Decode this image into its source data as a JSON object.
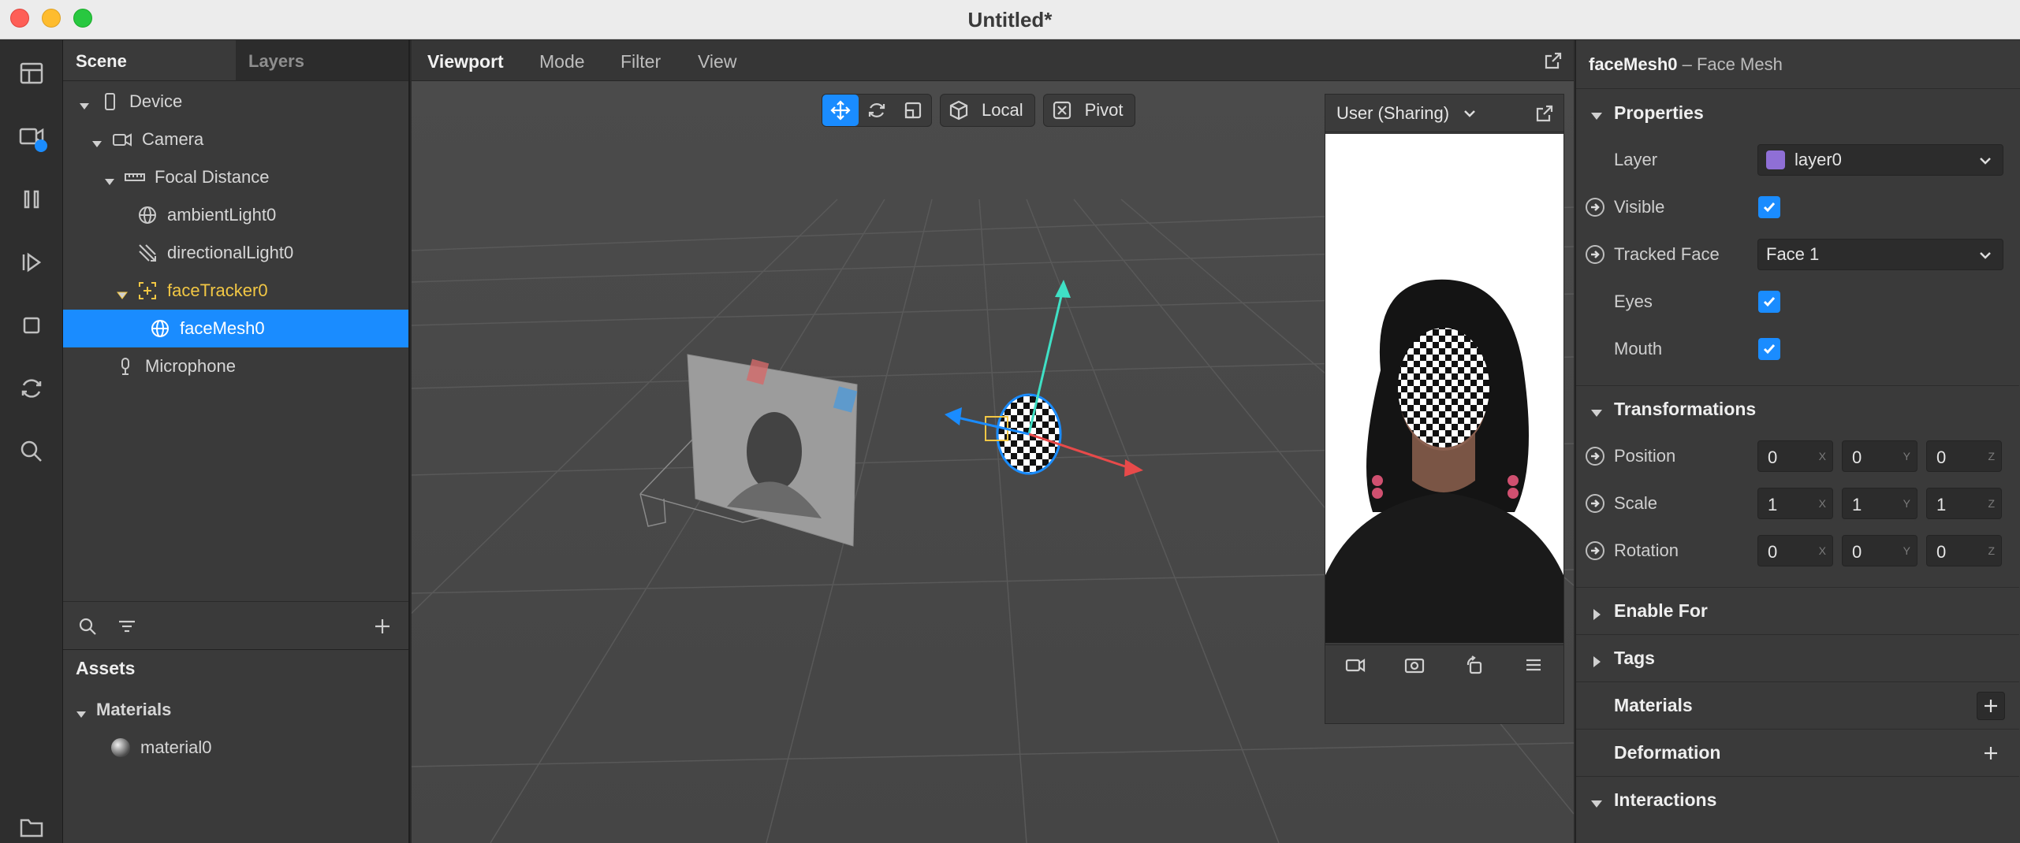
{
  "window": {
    "title": "Untitled*"
  },
  "scene_panel": {
    "tabs": [
      {
        "label": "Scene"
      },
      {
        "label": "Layers"
      }
    ],
    "tree": [
      {
        "label": "Device"
      },
      {
        "label": "Camera"
      },
      {
        "label": "Focal Distance"
      },
      {
        "label": "ambientLight0"
      },
      {
        "label": "directionalLight0"
      },
      {
        "label": "faceTracker0"
      },
      {
        "label": "faceMesh0"
      },
      {
        "label": "Microphone"
      }
    ]
  },
  "assets": {
    "title": "Assets",
    "tree": [
      {
        "label": "Materials"
      },
      {
        "label": "material0"
      }
    ]
  },
  "viewport": {
    "tabs": [
      {
        "label": "Viewport"
      },
      {
        "label": "Mode"
      },
      {
        "label": "Filter"
      },
      {
        "label": "View"
      }
    ],
    "toolbar": {
      "local_label": "Local",
      "pivot_label": "Pivot"
    }
  },
  "simulator": {
    "device_label": "User (Sharing)"
  },
  "inspector": {
    "object_name": "faceMesh0",
    "object_type": "– Face Mesh",
    "sections": {
      "properties": "Properties",
      "transformations": "Transformations",
      "enable_for": "Enable For",
      "tags": "Tags",
      "materials": "Materials",
      "deformation": "Deformation",
      "interactions": "Interactions"
    },
    "layer": {
      "label": "Layer",
      "value": "layer0"
    },
    "visible": {
      "label": "Visible"
    },
    "tracked_face": {
      "label": "Tracked Face",
      "value": "Face 1"
    },
    "eyes": {
      "label": "Eyes"
    },
    "mouth": {
      "label": "Mouth"
    },
    "position": {
      "label": "Position",
      "x": "0",
      "y": "0",
      "z": "0"
    },
    "scale": {
      "label": "Scale",
      "x": "1",
      "y": "1",
      "z": "1"
    },
    "rotation": {
      "label": "Rotation",
      "x": "0",
      "y": "0",
      "z": "0"
    },
    "axes": {
      "x": "X",
      "y": "Y",
      "z": "Z"
    }
  }
}
